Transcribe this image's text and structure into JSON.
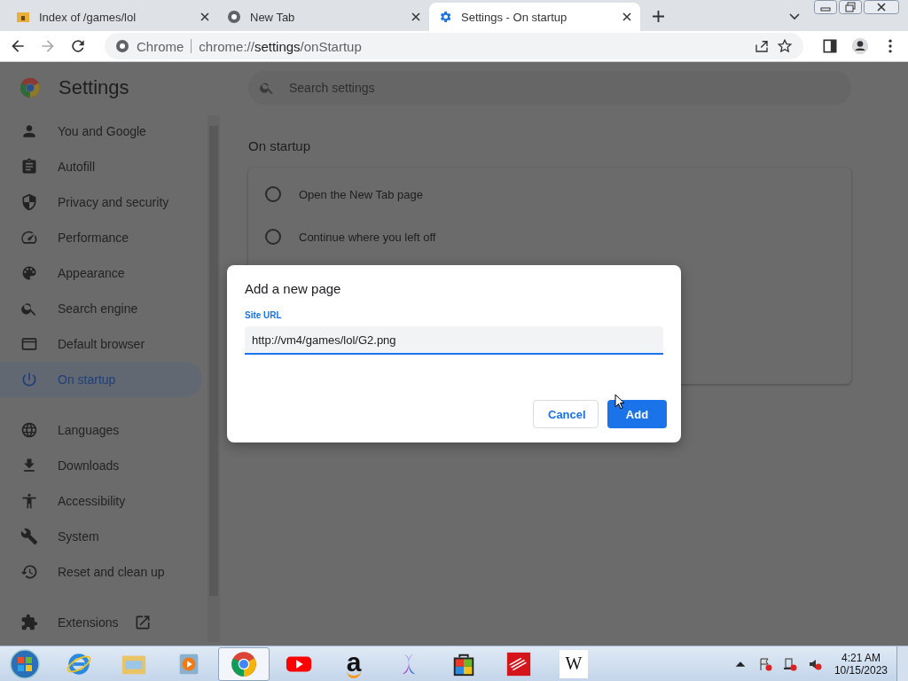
{
  "tabs": [
    {
      "title": "Index of /games/lol",
      "kind": "folder",
      "selected": false
    },
    {
      "title": "New Tab",
      "kind": "chrome",
      "selected": false
    },
    {
      "title": "Settings - On startup",
      "kind": "gear",
      "selected": true
    }
  ],
  "toolbar": {
    "chip": "Chrome",
    "url_scheme": "chrome://",
    "url_host": "settings",
    "url_path": "/onStartup"
  },
  "sidebar": {
    "title": "Settings",
    "groups": [
      [
        {
          "label": "You and Google",
          "selected": false
        },
        {
          "label": "Autofill",
          "selected": false
        },
        {
          "label": "Privacy and security",
          "selected": false
        },
        {
          "label": "Performance",
          "selected": false
        },
        {
          "label": "Appearance",
          "selected": false
        },
        {
          "label": "Search engine",
          "selected": false
        },
        {
          "label": "Default browser",
          "selected": false
        },
        {
          "label": "On startup",
          "selected": true
        }
      ],
      [
        {
          "label": "Languages",
          "selected": false
        },
        {
          "label": "Downloads",
          "selected": false
        },
        {
          "label": "Accessibility",
          "selected": false
        },
        {
          "label": "System",
          "selected": false
        },
        {
          "label": "Reset and clean up",
          "selected": false
        }
      ],
      [
        {
          "label": "Extensions",
          "selected": false,
          "external": true
        }
      ]
    ]
  },
  "search": {
    "placeholder": "Search settings"
  },
  "section": {
    "title": "On startup",
    "options": [
      {
        "label": "Open the New Tab page",
        "checked": false
      },
      {
        "label": "Continue where you left off",
        "checked": false
      }
    ]
  },
  "dialog": {
    "title": "Add a new page",
    "field_label": "Site URL",
    "value": "http://vm4/games/lol/G2.png",
    "buttons": [
      {
        "label": "Cancel",
        "kind": "secondary"
      },
      {
        "label": "Add",
        "kind": "primary"
      }
    ]
  },
  "taskbar": {
    "items": [
      {
        "kind": "ie",
        "selected": false
      },
      {
        "kind": "explorer",
        "selected": false
      },
      {
        "kind": "media",
        "selected": false
      },
      {
        "kind": "chrome",
        "selected": true
      },
      {
        "kind": "youtube",
        "selected": false
      },
      {
        "kind": "amazon",
        "glyph": "a",
        "selected": false
      },
      {
        "kind": "copilot",
        "selected": false
      },
      {
        "kind": "store",
        "selected": false
      },
      {
        "kind": "bank",
        "selected": false
      },
      {
        "kind": "wiki",
        "glyph": "W",
        "selected": false
      }
    ],
    "time": "4:21 AM",
    "date": "10/15/2023"
  }
}
